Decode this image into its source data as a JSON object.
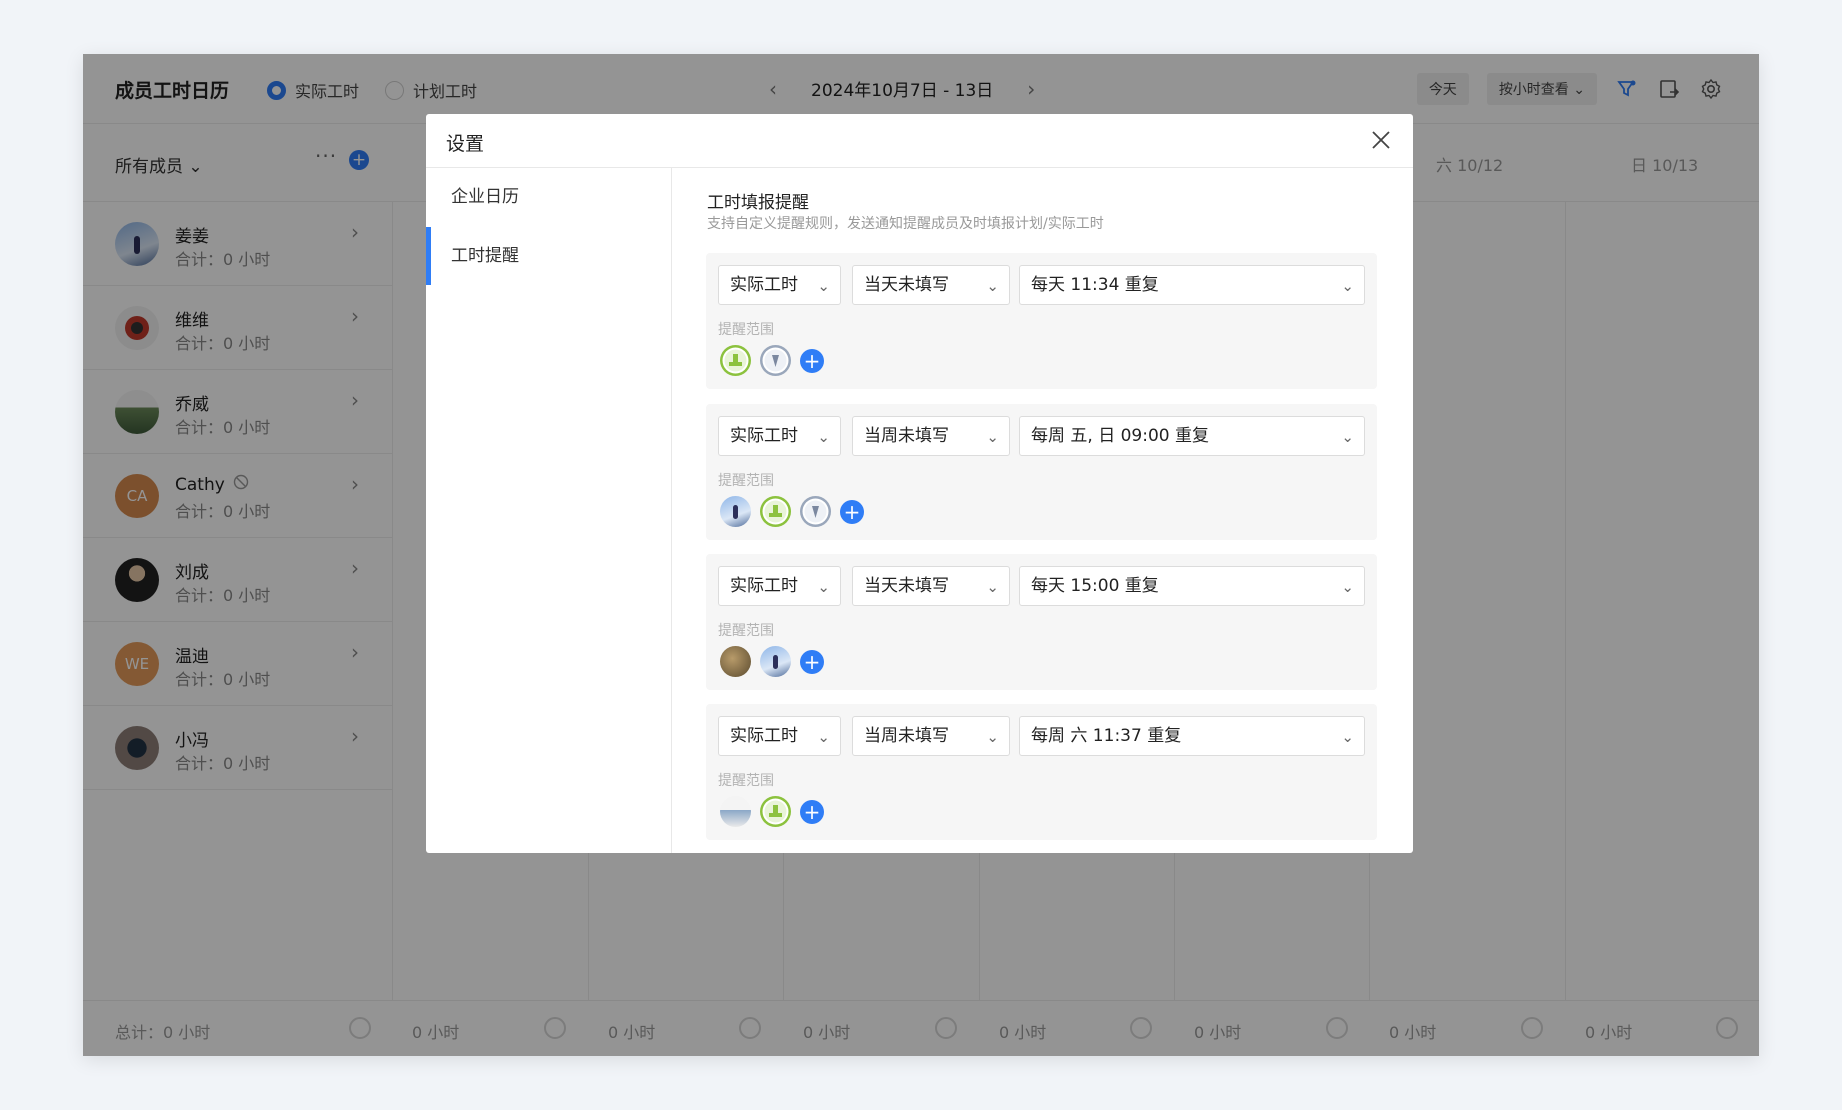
{
  "app": {
    "title": "成员工时日历",
    "mode_actual": "实际工时",
    "mode_planned": "计划工时",
    "week_range": "2024年10月7日 - 13日",
    "today_btn": "今天",
    "view_btn": "按小时查看",
    "members_filter": "所有成员",
    "more_label": "···",
    "day_sat": "六 10/12",
    "day_sun": "日 10/13"
  },
  "members": [
    {
      "name": "姜姜",
      "total": "合计：0 小时"
    },
    {
      "name": "维维",
      "total": "合计：0 小时"
    },
    {
      "name": "乔威",
      "total": "合计：0 小时"
    },
    {
      "name": "Cathy",
      "total": "合计：0 小时",
      "initials": "CA"
    },
    {
      "name": "刘成",
      "total": "合计：0 小时"
    },
    {
      "name": "温迪",
      "total": "合计：0 小时",
      "initials": "WE"
    },
    {
      "name": "小冯",
      "total": "合计：0 小时"
    }
  ],
  "footer": {
    "total": "总计：0 小时",
    "cells": [
      "0 小时",
      "0 小时",
      "0 小时",
      "0 小时",
      "0 小时",
      "0 小时",
      "0 小时"
    ]
  },
  "modal": {
    "title": "设置",
    "side_items": [
      "企业日历",
      "工时提醒"
    ],
    "section_title": "工时填报提醒",
    "section_desc": "支持自定义提醒规则，发送通知提醒成员及时填报计划/实际工时",
    "scope_label": "提醒范围",
    "rules": [
      {
        "type": "实际工时",
        "condition": "当天未填写",
        "schedule": "每天 11:34 重复"
      },
      {
        "type": "实际工时",
        "condition": "当周未填写",
        "schedule": "每周 五, 日 09:00 重复"
      },
      {
        "type": "实际工时",
        "condition": "当天未填写",
        "schedule": "每天 15:00 重复"
      },
      {
        "type": "实际工时",
        "condition": "当周未填写",
        "schedule": "每周 六 11:37 重复"
      }
    ]
  },
  "colors": {
    "accent": "#2f7df6",
    "cathy_avatar": "#d68a4e",
    "wendy_avatar": "#e39a5a",
    "green_avatar": "#8cc23e"
  }
}
